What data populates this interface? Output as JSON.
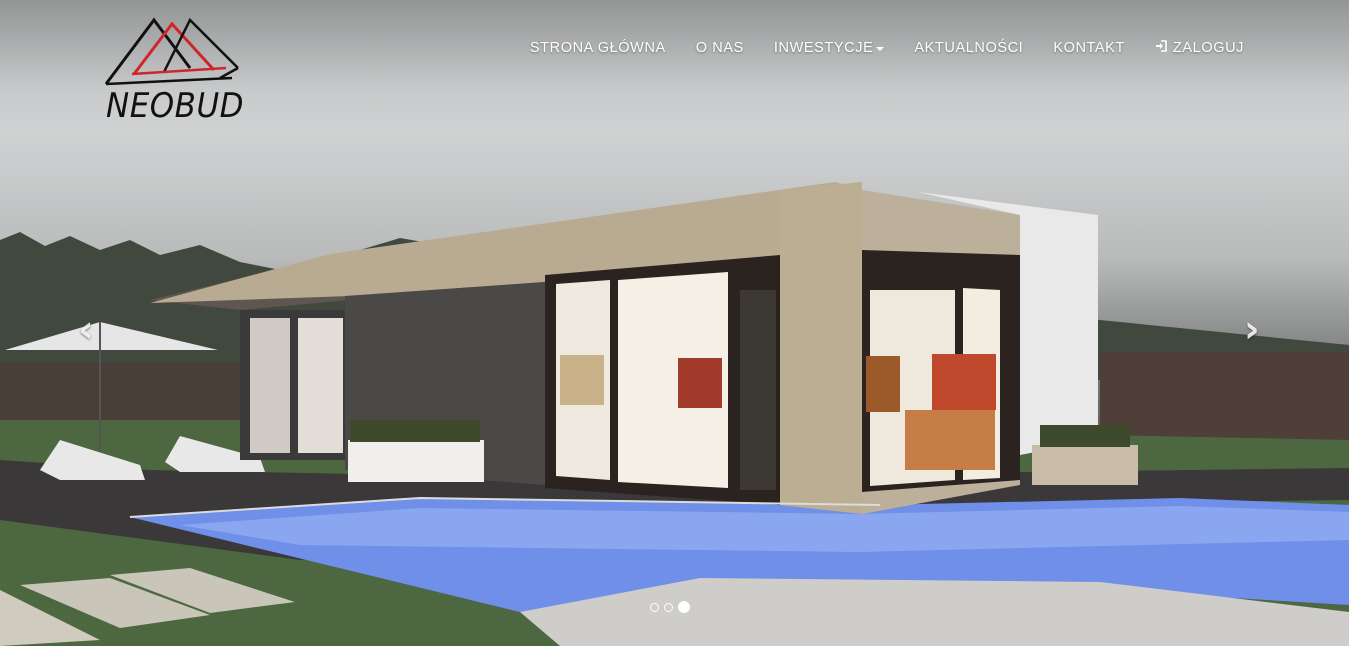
{
  "brand": {
    "name": "NEOBUD",
    "logo_icon": "triangles-logo-icon",
    "colors": {
      "dark": "#111111",
      "accent": "#d0262b"
    }
  },
  "nav": {
    "items": [
      {
        "label": "STRONA GŁÓWNA"
      },
      {
        "label": "O NAS"
      },
      {
        "label": "INWESTYCJE",
        "has_dropdown": true
      },
      {
        "label": "AKTUALNOŚCI"
      },
      {
        "label": "KONTAKT"
      },
      {
        "label": "ZALOGUJ",
        "icon": "login-icon"
      }
    ],
    "text_color": "#ffffff"
  },
  "carousel": {
    "prev_icon": "‹",
    "next_icon": "›",
    "slide_count": 3,
    "active_index": 2
  }
}
